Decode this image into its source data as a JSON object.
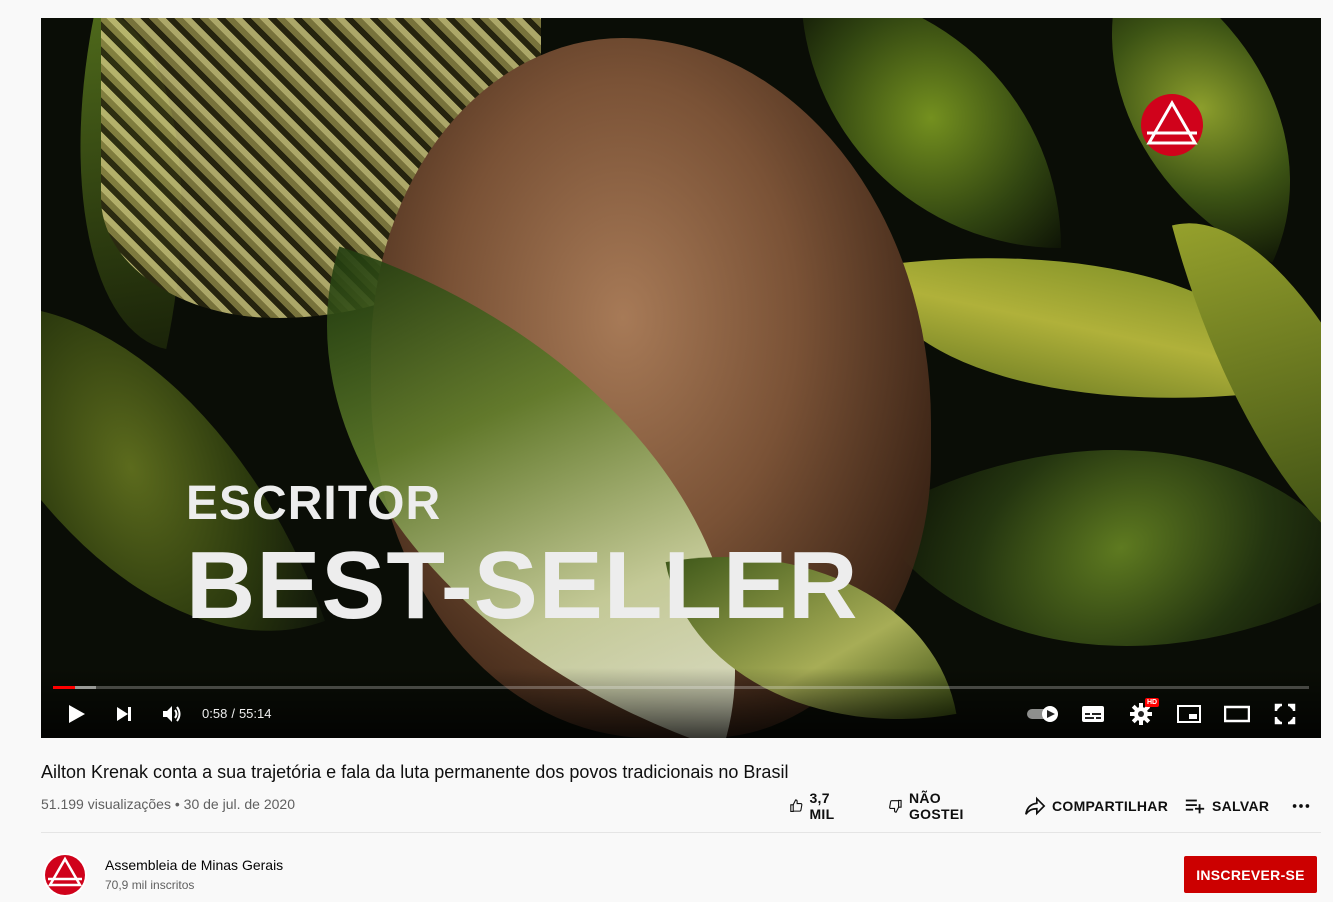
{
  "player": {
    "overlay_line1": "ESCRITOR",
    "overlay_line2": "BEST-SELLER",
    "time_current": "0:58",
    "time_separator": "/",
    "time_total": "55:14",
    "progress_played_fraction": 0.0175,
    "progress_buffered_fraction": 0.034,
    "hd_badge": "HD",
    "progress_color": "#ff0000",
    "icons": [
      "play-icon",
      "next-icon",
      "volume-icon",
      "autoplay-toggle-icon",
      "subtitles-icon",
      "settings-icon",
      "miniplayer-icon",
      "theater-mode-icon",
      "fullscreen-icon"
    ]
  },
  "video": {
    "title": "Ailton Krenak conta a sua trajetória e fala da luta permanente dos povos tradicionais no Brasil",
    "views": "51.199 visualizações",
    "bullet": "•",
    "date": "30 de jul. de 2020"
  },
  "actions": {
    "like_count": "3,7 MIL",
    "dislike_label": "NÃO GOSTEI",
    "share_label": "COMPARTILHAR",
    "save_label": "SALVAR"
  },
  "channel": {
    "name": "Assembleia de Minas Gerais",
    "subscribers": "70,9 mil inscritos",
    "brand_color": "#d0021b"
  },
  "subscribe": {
    "label": "INSCREVER-SE",
    "color": "#cc0000"
  }
}
